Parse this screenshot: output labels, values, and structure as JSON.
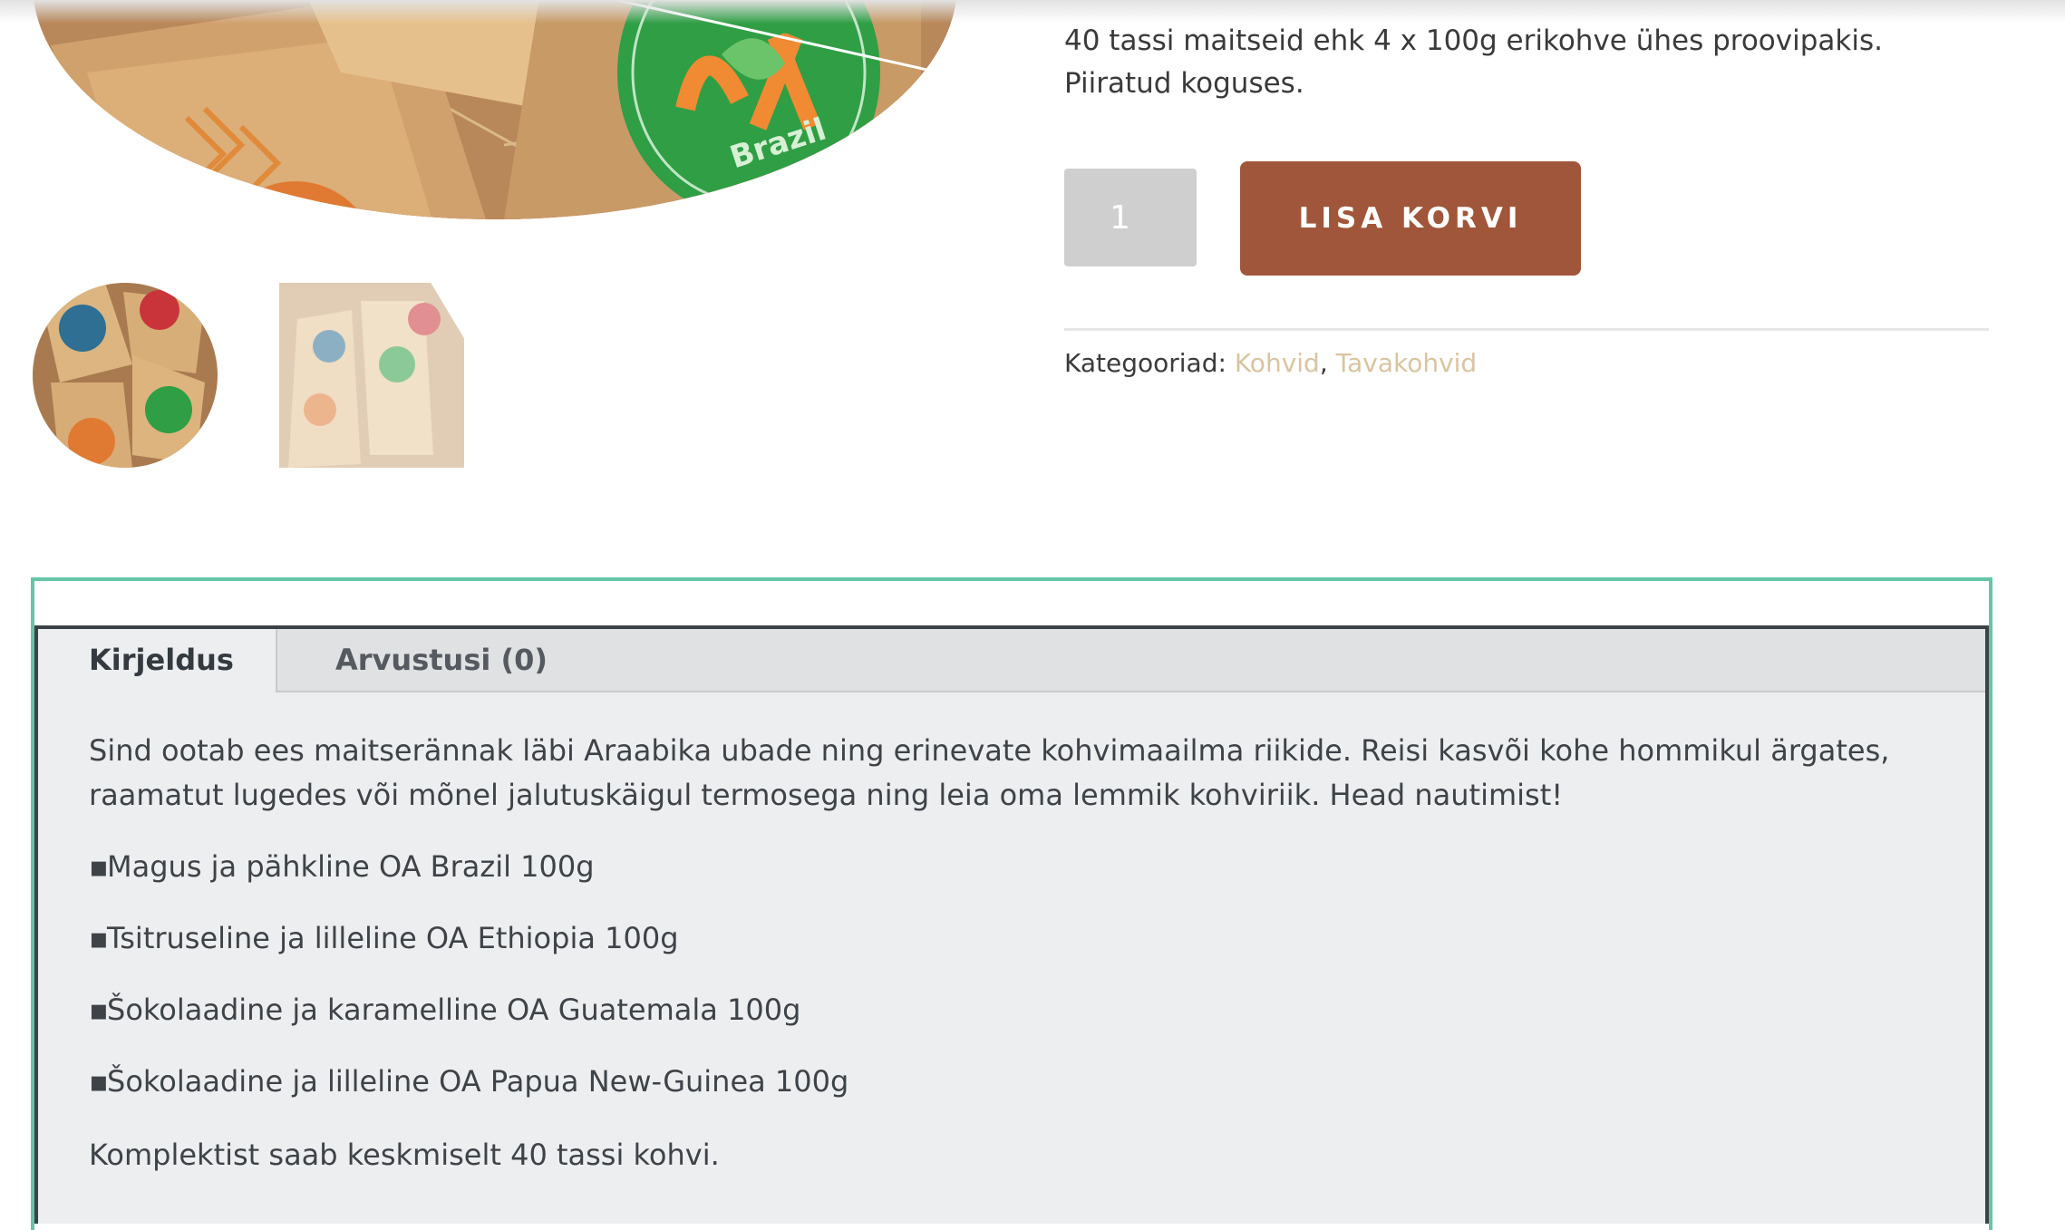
{
  "gallery": {
    "main_image_alt": "OA Brazil",
    "thumbnails": [
      "coffee-bags-thumbnail",
      "coffee-bags-thumbnail-2"
    ]
  },
  "product": {
    "short_description": [
      "40 tassi maitseid ehk 4 x 100g erikohve ühes proovipakis.",
      "Piiratud koguses."
    ],
    "quantity": "1",
    "add_to_cart_label": "LISA KORVI",
    "categories_label": "Kategooriad:",
    "categories": [
      "Kohvid",
      "Tavakohvid"
    ],
    "category_separator": ","
  },
  "tabs": [
    {
      "label": "Kirjeldus",
      "active": true
    },
    {
      "label": "Arvustusi (0)",
      "active": false
    }
  ],
  "description": {
    "intro": "Sind ootab ees maitserännak läbi Araabika ubade ning erinevate kohvimaailma riikide. Reisi kasvõi kohe hommikul ärgates, raamatut lugedes või mõnel jalutuskäigul termosega ning leia oma lemmik kohviriik. Head nautimist!",
    "bullet": "▪",
    "items": [
      "Magus ja pähkline OA Brazil 100g",
      "Tsitruseline ja lilleline OA Ethiopia 100g",
      "Šokolaadine ja karamelline OA Guatemala 100g",
      "Šokolaadine ja lilleline OA Papua New-Guinea 100g"
    ],
    "summary": "Komplektist saab keskmiselt 40 tassi kohvi."
  },
  "colors": {
    "accent_button": "#a0563a",
    "category_link": "#d9c4a0",
    "frame_outer": "#66c4a8",
    "frame_inner": "#3b4248"
  }
}
